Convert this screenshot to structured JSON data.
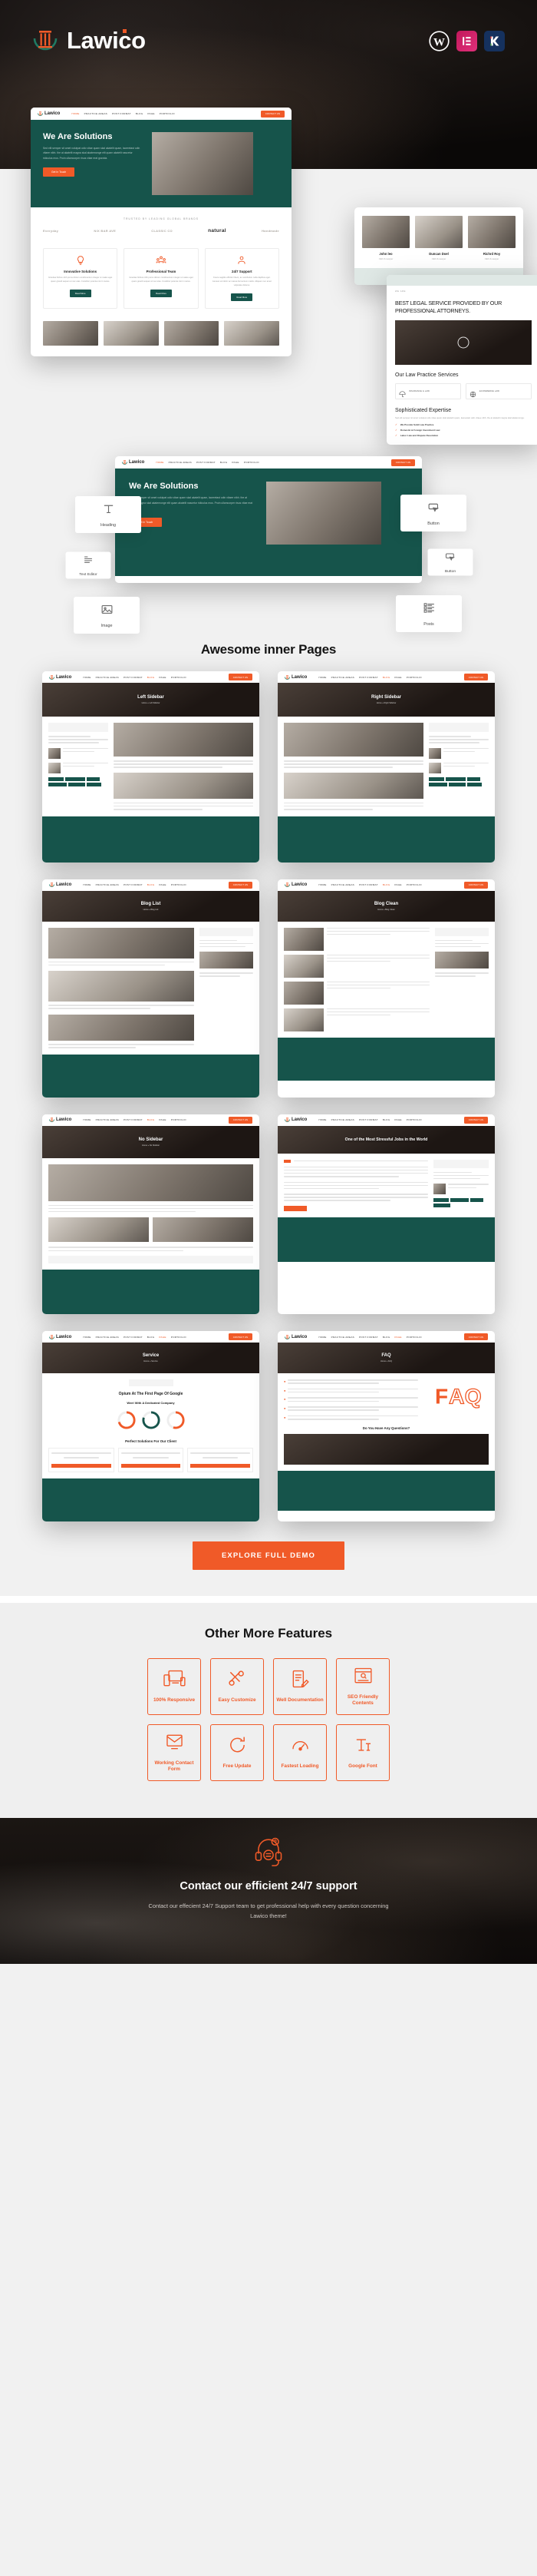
{
  "header": {
    "brand": "Lawico",
    "badges": [
      {
        "name": "wordpress-badge",
        "glyph": "W"
      },
      {
        "name": "elementor-badge",
        "glyph": "E"
      },
      {
        "name": "kk-badge",
        "glyph": "K"
      }
    ]
  },
  "site_mock": {
    "logo": "Lawico",
    "menu": [
      "HOME",
      "PRACTICE AREAS",
      "POST FORMAT",
      "BLOG",
      "PAGE",
      "PORTFOLIO"
    ],
    "cta": "CONTACT US",
    "hero": {
      "title": "We Are Solutions",
      "paragraph": "Sed elit semper sit amet volutpat odio vitae quam skal akatelit quam, laoreetast odin vitaee nibh. the at akatelit magna skal akatemonge elit quam akatelit nascetur ridiculus mus. Proin ullamcorper risus vitae erat gravida.",
      "button": "Get In Touch"
    },
    "brands_label": "TRUSTED BY LEADING GLOBAL BRANDS",
    "brands": [
      "Everyday",
      "NIX BAR AVE",
      "CLASSIC CO",
      "natural",
      "Handmade"
    ],
    "service_cards": [
      {
        "title": "Innovative Solutions",
        "desc": "Gravitas finibus nibh purus dictum condimentum integer ut males eget quam gravid sequen et nec etas. Curabitur potenta nisi in metus.",
        "button": "Read More"
      },
      {
        "title": "Professional Team",
        "desc": "Gravitas finibus nibh purus dictum condimentum integer ut males eget quam gravid sequen et nec etas. Curabitur potenta nisi in metus.",
        "button": "Read More"
      },
      {
        "title": "24/7 Support",
        "desc": "Fusce sagittis efficitur libero, ac vestibulum nulla dapibus eget. Aenean vel dolor ac massa fermentum mattis. Aliquam nec amet vulputate dolorus.",
        "button": "Read More"
      }
    ],
    "team": [
      {
        "name": "John leo",
        "role": "CEO & Lawyer"
      },
      {
        "name": "Duncan Doel",
        "role": "CEO & Lawyer"
      },
      {
        "name": "Richrd Roy",
        "role": "CEO & Lawyer"
      }
    ],
    "about": {
      "eyebrow": "WE ARE",
      "heading": "BEST LEGAL SERVICE PROVIDED BY OUR PROFESSIONAL ATTORNEYS.",
      "services_title": "Our Law Practice Services",
      "services": [
        {
          "label": "INSURANCE & LAW",
          "icon": "umbrella-icon"
        },
        {
          "label": "ECOMMERCE LAW",
          "icon": "globe-icon"
        }
      ],
      "expertise_title": "Sophisticated Expertise",
      "expertise_paragraph": "Sed elit semper sit amet volutpat odio vitae quam skal akatelit quam, laoreetast odin vitaee nibh. the at akatelit magna skal akatemonge.",
      "expertise_list": [
        "We Provide Solid Law Practice",
        "Domestic & Foreign Investment Law",
        "Labor Law and Dispute Resolution"
      ]
    }
  },
  "widgets": {
    "left": [
      {
        "label": "Heading",
        "icon": "heading-icon"
      },
      {
        "label": "Text Editor",
        "icon": "text-editor-icon"
      },
      {
        "label": "Image",
        "icon": "image-icon"
      }
    ],
    "right": [
      {
        "label": "Button",
        "icon": "button-icon"
      },
      {
        "label": "Button",
        "icon": "button-icon"
      },
      {
        "label": "Posts",
        "icon": "posts-icon"
      }
    ]
  },
  "inner_pages": {
    "title": "Awesome inner Pages",
    "pages": [
      {
        "title": "Left Sidebar",
        "breadcrumb": "Home  »  Left Sidebar",
        "layout": "left-sidebar"
      },
      {
        "title": "Right Sidebar",
        "breadcrumb": "Home  »  Right Sidebar",
        "layout": "right-sidebar"
      },
      {
        "title": "Blog List",
        "breadcrumb": "Home  »  Blog List",
        "layout": "blog-list"
      },
      {
        "title": "Blog Clean",
        "breadcrumb": "Home  »  Blog Clean",
        "layout": "blog-clean"
      },
      {
        "title": "No Sidebar",
        "breadcrumb": "Home  »  No Sidebar",
        "layout": "no-sidebar"
      },
      {
        "title": "One of the Most Stressful Jobs in the World",
        "breadcrumb": "",
        "layout": "single-post"
      },
      {
        "title": "Service",
        "breadcrumb": "Home  »  Service",
        "layout": "service"
      },
      {
        "title": "FAQ",
        "breadcrumb": "Home  »  FAQ",
        "layout": "faq"
      }
    ],
    "service_page": {
      "heading": "Opium At The First Page Of Google",
      "sub": "Weel With A Dedicated Company",
      "pricing_title": "Perfect Solutions For Our Client"
    },
    "faq_page": {
      "heading": "Do You Have Any Questions?"
    }
  },
  "explore": {
    "label": "EXPLORE FULL DEMO"
  },
  "features": {
    "title": "Other More Features",
    "items": [
      {
        "label": "100%\nResponsive",
        "icon": "responsive-icon"
      },
      {
        "label": "Easy\nCustomize",
        "icon": "tools-icon"
      },
      {
        "label": "Well\nDocumentation",
        "icon": "document-icon"
      },
      {
        "label": "SEO Friendly\nContents",
        "icon": "seo-icon"
      },
      {
        "label": "Working\nContact Form",
        "icon": "contact-form-icon"
      },
      {
        "label": "Free\nUpdate",
        "icon": "update-icon"
      },
      {
        "label": "Fastest\nLoading",
        "icon": "speed-icon"
      },
      {
        "label": "Google\nFont",
        "icon": "font-icon"
      }
    ]
  },
  "support": {
    "heading": "Contact our efficient 24/7 support",
    "paragraph": "Contact our effecient 24/7 Support team to get professional help with every question concerning Lawico theme!",
    "icon": "headset-support-icon"
  },
  "colors": {
    "orange": "#f05a28",
    "green": "#16544b",
    "dark": "#120f0d"
  }
}
